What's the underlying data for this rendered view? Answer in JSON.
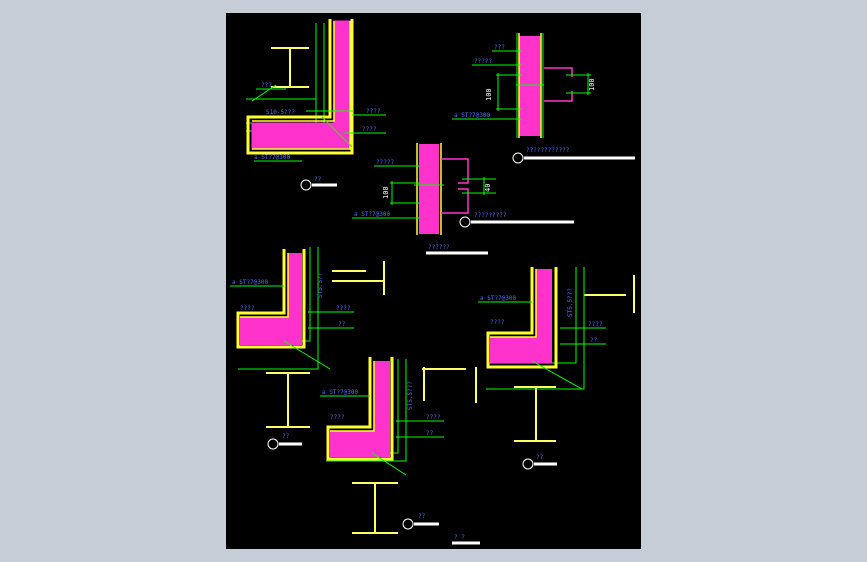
{
  "colors": {
    "background": "#c7cdd6",
    "viewport": "#000000",
    "insulation": "#ff33cc",
    "panel_skin": "#ffff33",
    "steel": "#ffff66",
    "dimension": "#00ff00",
    "leader": "#00ff00",
    "text": "#4a6bff",
    "title_bar": "#ffffff",
    "marker": "#ffffff"
  },
  "labels": {
    "detail1_screw_a": "S10-5???",
    "detail1_label_b": "????",
    "detail1_label_c": "????",
    "detail1_label_d": "???",
    "detail1_note": "a  ST?7@300",
    "detail1_title": "??",
    "detail2_label_top": "???",
    "detail2_label_mid": "?????",
    "detail2_dim": "100",
    "detail2_dim_b": "100",
    "detail2_note": "a  ST?7@300",
    "detail2_title": "????????????",
    "detail3_label_top": "?????",
    "detail3_dim": "100",
    "detail3_dim_b": "40",
    "detail3_note": "a  ST?7@300",
    "detail3_title": "?????????",
    "detail3_sub_title": "??????",
    "detail4_note": "a  ST?7@300",
    "detail4_screw": "ST5.5??",
    "detail4_label_b": "????",
    "detail4_label_c": "????",
    "detail4_label_d": "??",
    "detail4_title": "??",
    "detail5_note": "a  ST?7@300",
    "detail5_screw": "ST5.5???",
    "detail5_label_b": "????",
    "detail5_label_c": "????",
    "detail5_label_d": "??",
    "detail5_title": "??",
    "detail6_note": "a  ST?7@300",
    "detail6_screw": "ST5.5???",
    "detail6_label_b": "????",
    "detail6_label_c": "????",
    "detail6_label_d": "??",
    "detail6_title": "??",
    "sheet_title": "?  ?"
  }
}
